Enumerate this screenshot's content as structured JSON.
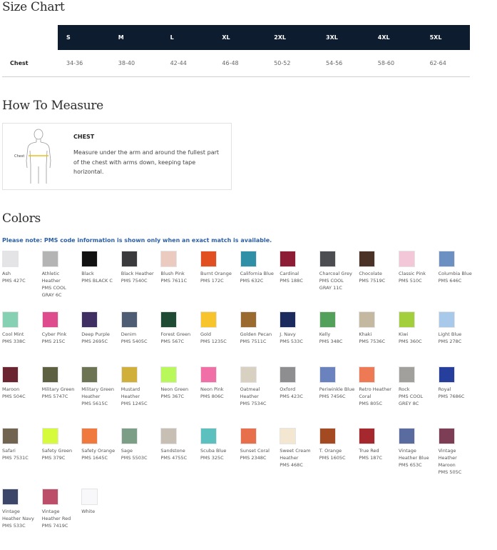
{
  "size_chart": {
    "title": "Size Chart",
    "sizes": [
      "S",
      "M",
      "L",
      "XL",
      "2XL",
      "3XL",
      "4XL",
      "5XL"
    ],
    "row_label": "Chest",
    "chest": [
      "34-36",
      "38-40",
      "42-44",
      "46-48",
      "50-52",
      "54-56",
      "58-60",
      "62-64"
    ]
  },
  "measure": {
    "title": "How To Measure",
    "figure_label": "Chest",
    "item_title": "CHEST",
    "description": "Measure under the arm and around the fullest part of the chest with arms down, keeping tape horizontal."
  },
  "colors": {
    "title": "Colors",
    "note": "Please note: PMS code information is shown only when an exact match is available.",
    "swatches": [
      {
        "name": "Ash",
        "pms": "PMS 427C",
        "hex": "#e4e4e6"
      },
      {
        "name": "Athletic Heather",
        "pms": "PMS COOL GRAY 6C",
        "hex": "#b4b4b4"
      },
      {
        "name": "Black",
        "pms": "PMS BLACK C",
        "hex": "#111111"
      },
      {
        "name": "Black Heather",
        "pms": "PMS 7540C",
        "hex": "#3a3a3c"
      },
      {
        "name": "Blush Pink",
        "pms": "PMS 7611C",
        "hex": "#ebcbc0"
      },
      {
        "name": "Burnt Orange",
        "pms": "PMS 172C",
        "hex": "#e14e1f"
      },
      {
        "name": "California Blue",
        "pms": "PMS 632C",
        "hex": "#2f8fa6"
      },
      {
        "name": "Cardinal",
        "pms": "PMS 188C",
        "hex": "#8c1d35"
      },
      {
        "name": "Charcoal Grey",
        "pms": "PMS COOL GRAY 11C",
        "hex": "#4c4d50"
      },
      {
        "name": "Chocolate",
        "pms": "PMS 7519C",
        "hex": "#4a3326"
      },
      {
        "name": "Classic Pink",
        "pms": "PMS 510C",
        "hex": "#f3c6d8"
      },
      {
        "name": "Columbia Blue",
        "pms": "PMS 646C",
        "hex": "#6d90c3"
      },
      {
        "name": "Cool Mint",
        "pms": "PMS 338C",
        "hex": "#86d1b4"
      },
      {
        "name": "Cyber Pink",
        "pms": "PMS 215C",
        "hex": "#df4c8d"
      },
      {
        "name": "Deep Purple",
        "pms": "PMS 2695C",
        "hex": "#3f2f62"
      },
      {
        "name": "Denim",
        "pms": "PMS 5405C",
        "hex": "#4f5d74"
      },
      {
        "name": "Forest Green",
        "pms": "PMS 567C",
        "hex": "#1f4a33"
      },
      {
        "name": "Gold",
        "pms": "PMS 1235C",
        "hex": "#f7c42c"
      },
      {
        "name": "Golden Pecan",
        "pms": "PMS 7511C",
        "hex": "#9a6a2f"
      },
      {
        "name": "J. Navy",
        "pms": "PMS 533C",
        "hex": "#1c2b5e"
      },
      {
        "name": "Kelly",
        "pms": "PMS 348C",
        "hex": "#52a05a"
      },
      {
        "name": "Khaki",
        "pms": "PMS 7536C",
        "hex": "#c4b8a0"
      },
      {
        "name": "Kiwi",
        "pms": "PMS 360C",
        "hex": "#a3cf3d"
      },
      {
        "name": "Light Blue",
        "pms": "PMS 278C",
        "hex": "#a8c9ea"
      },
      {
        "name": "Maroon",
        "pms": "PMS 504C",
        "hex": "#6a2530"
      },
      {
        "name": "Military Green",
        "pms": "PMS 5747C",
        "hex": "#5d6142"
      },
      {
        "name": "Military Green Heather",
        "pms": "PMS 5615C",
        "hex": "#6c7454"
      },
      {
        "name": "Mustard Heather",
        "pms": "PMS 1245C",
        "hex": "#d0b03a"
      },
      {
        "name": "Neon Green",
        "pms": "PMS 367C",
        "hex": "#b9f85a"
      },
      {
        "name": "Neon Pink",
        "pms": "PMS 806C",
        "hex": "#ef6fa6"
      },
      {
        "name": "Oatmeal Heather",
        "pms": "PMS 7534C",
        "hex": "#d8d0c1"
      },
      {
        "name": "Oxford",
        "pms": "PMS 423C",
        "hex": "#8e8e90"
      },
      {
        "name": "Periwinkle Blue",
        "pms": "PMS 7456C",
        "hex": "#6a82bd"
      },
      {
        "name": "Retro Heather Coral",
        "pms": "PMS 805C",
        "hex": "#ee7a55"
      },
      {
        "name": "Rock",
        "pms": "PMS COOL GREY 8C",
        "hex": "#a1a09c"
      },
      {
        "name": "Royal",
        "pms": "PMS 7686C",
        "hex": "#263e9c"
      },
      {
        "name": "Safari",
        "pms": "PMS 7531C",
        "hex": "#716552"
      },
      {
        "name": "Safety Green",
        "pms": "PMS 379C",
        "hex": "#d6fb3c"
      },
      {
        "name": "Safety Orange",
        "pms": "PMS 1645C",
        "hex": "#f07a3d"
      },
      {
        "name": "Sage",
        "pms": "PMS 5503C",
        "hex": "#7c9e87"
      },
      {
        "name": "Sandstone",
        "pms": "PMS 4755C",
        "hex": "#c8bfb4"
      },
      {
        "name": "Scuba Blue",
        "pms": "PMS 325C",
        "hex": "#5cc1be"
      },
      {
        "name": "Sunset Coral",
        "pms": "PMS 2348C",
        "hex": "#e76f4c"
      },
      {
        "name": "Sweet Cream Heather",
        "pms": "PMS 468C",
        "hex": "#f3e7d2"
      },
      {
        "name": "T. Orange",
        "pms": "PMS 1605C",
        "hex": "#a34a22"
      },
      {
        "name": "True Red",
        "pms": "PMS 187C",
        "hex": "#a5282f"
      },
      {
        "name": "Vintage Heather Blue",
        "pms": "PMS 653C",
        "hex": "#5a6ba0"
      },
      {
        "name": "Vintage Heather Maroon",
        "pms": "PMS 505C",
        "hex": "#7d3e55"
      },
      {
        "name": "Vintage Heather Navy",
        "pms": "PMS 533C",
        "hex": "#3c4668"
      },
      {
        "name": "Vintage Heather Red",
        "pms": "PMS 7419C",
        "hex": "#bd4e6a"
      },
      {
        "name": "White",
        "pms": "",
        "hex": "#f8f8fb"
      }
    ]
  }
}
